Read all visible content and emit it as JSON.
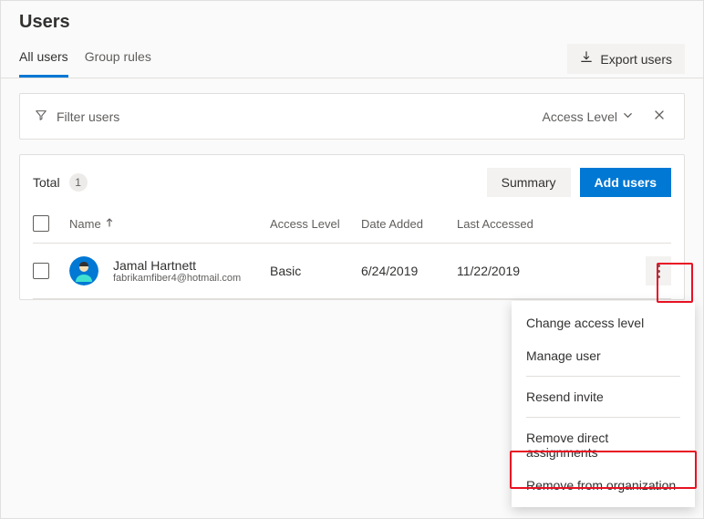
{
  "page_title": "Users",
  "tabs": {
    "all_users": "All users",
    "group_rules": "Group rules"
  },
  "export_label": "Export users",
  "filter": {
    "placeholder": "Filter users",
    "access_level_label": "Access Level"
  },
  "toolbar": {
    "total_label": "Total",
    "total_count": "1",
    "summary_label": "Summary",
    "add_users_label": "Add users"
  },
  "columns": {
    "name": "Name",
    "access_level": "Access Level",
    "date_added": "Date Added",
    "last_accessed": "Last Accessed"
  },
  "users": [
    {
      "name": "Jamal Hartnett",
      "email": "fabrikamfiber4@hotmail.com",
      "access_level": "Basic",
      "date_added": "6/24/2019",
      "last_accessed": "11/22/2019"
    }
  ],
  "context_menu": {
    "change_access": "Change access level",
    "manage_user": "Manage user",
    "resend_invite": "Resend invite",
    "remove_direct": "Remove direct assignments",
    "remove_org": "Remove from organization"
  }
}
